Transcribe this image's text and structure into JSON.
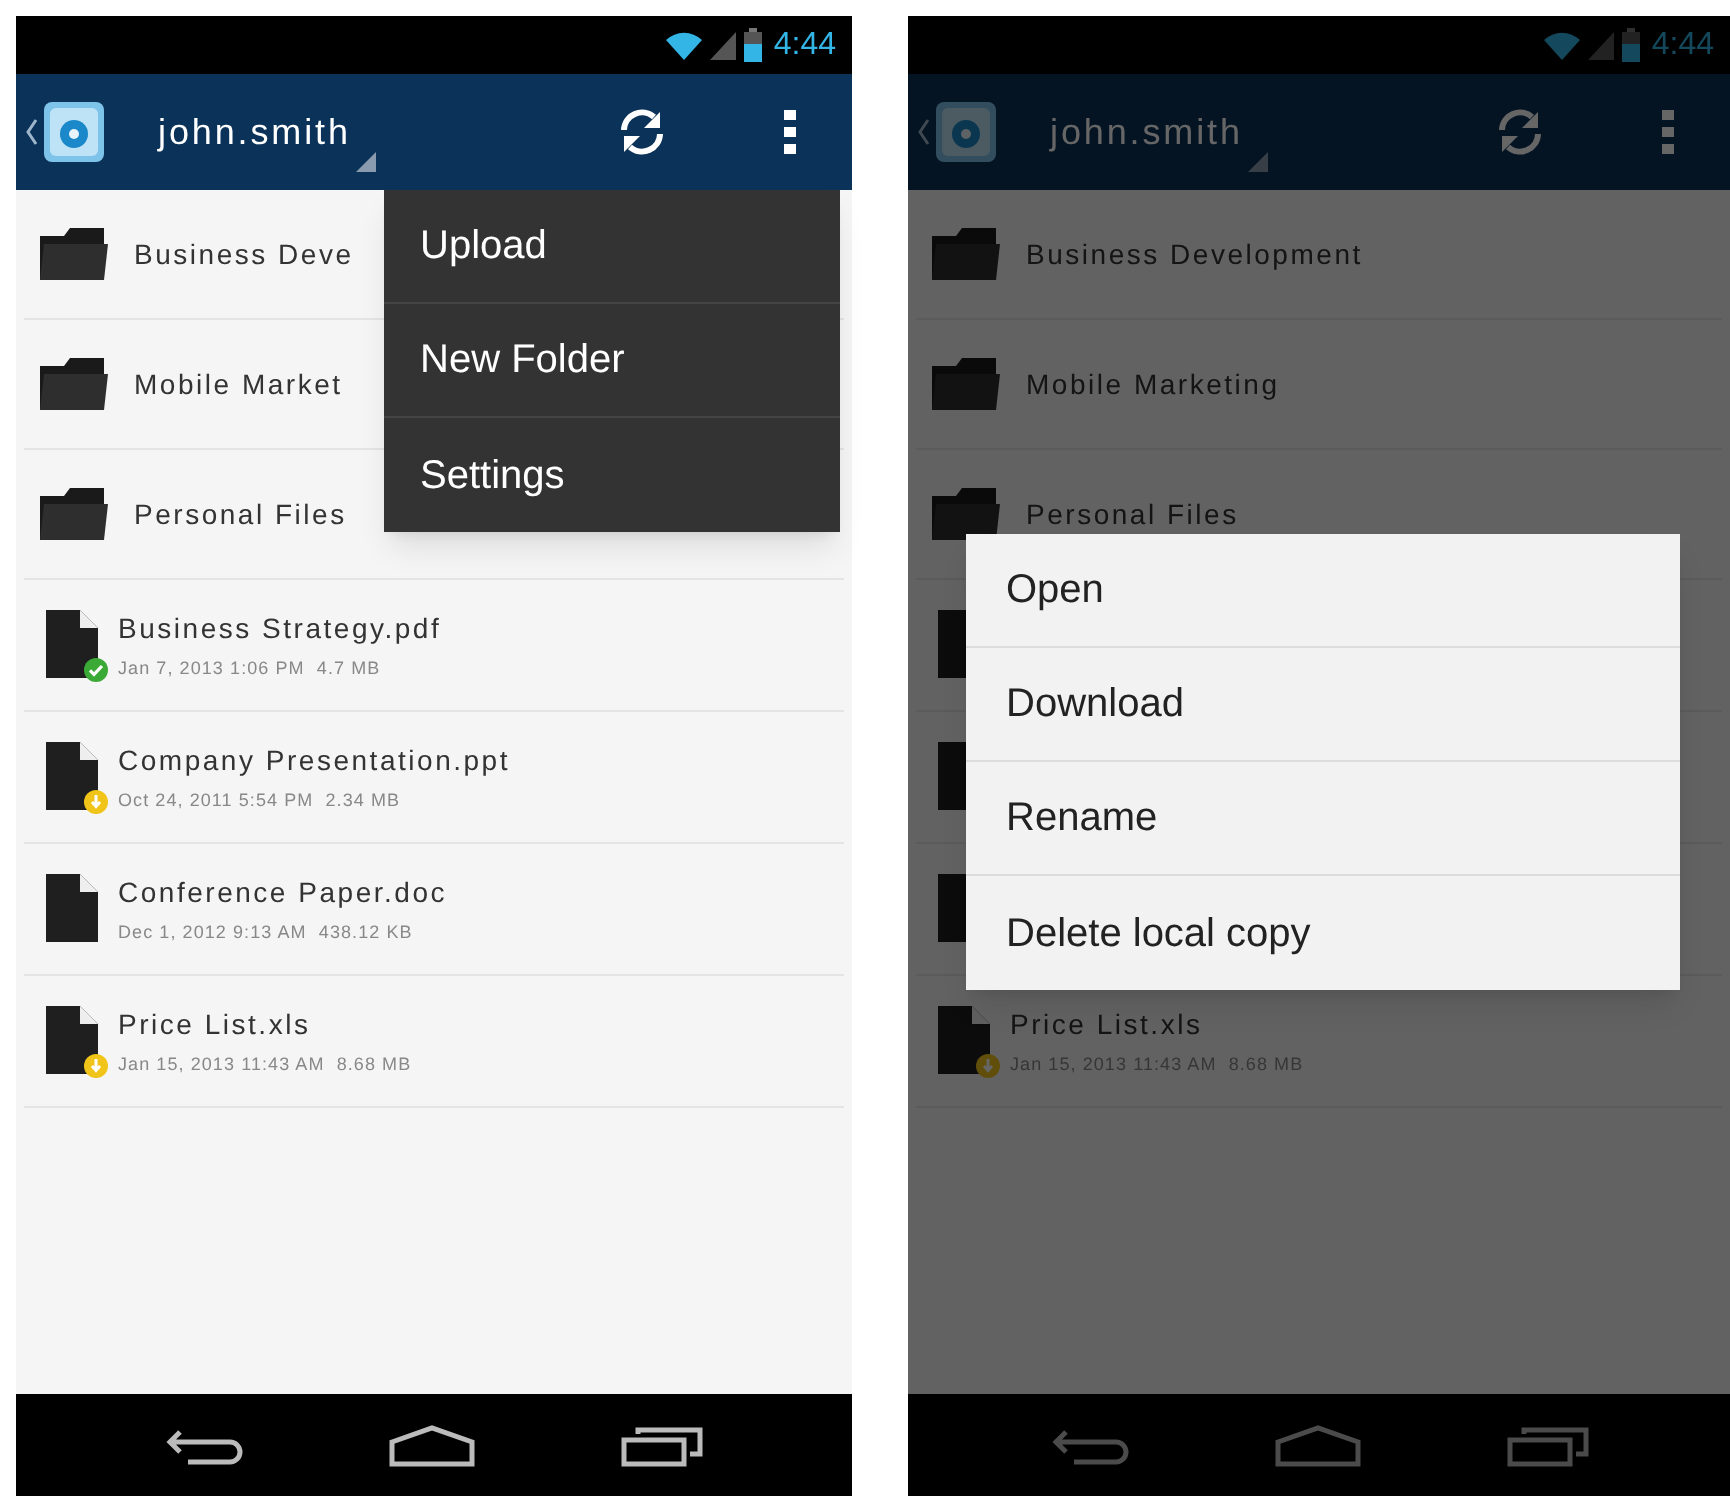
{
  "screens": [
    {
      "dimmed": false,
      "status_bar": {
        "time": "4:44"
      },
      "action_bar": {
        "title": "john.smith"
      },
      "items": [
        {
          "kind": "folder",
          "name": "Business Deve"
        },
        {
          "kind": "folder",
          "name": "Mobile Market"
        },
        {
          "kind": "folder",
          "name": "Personal Files"
        },
        {
          "kind": "file",
          "name": "Business Strategy.pdf",
          "meta": "Jan 7, 2013 1:06 PM  4.7 MB",
          "synced": true,
          "download_available": false
        },
        {
          "kind": "file",
          "name": "Company Presentation.ppt",
          "meta": "Oct 24, 2011 5:54 PM  2.34 MB",
          "synced": false,
          "download_available": true
        },
        {
          "kind": "file",
          "name": "Conference Paper.doc",
          "meta": "Dec 1, 2012 9:13 AM  438.12 KB",
          "synced": false,
          "download_available": false
        },
        {
          "kind": "file",
          "name": "Price List.xls",
          "meta": "Jan 15, 2013 11:43 AM  8.68 MB",
          "synced": false,
          "download_available": true
        }
      ],
      "overflow_menu": {
        "items": [
          "Upload",
          "New Folder",
          "Settings"
        ]
      }
    },
    {
      "dimmed": true,
      "status_bar": {
        "time": "4:44"
      },
      "action_bar": {
        "title": "john.smith"
      },
      "items": [
        {
          "kind": "folder",
          "name": "Business Development"
        },
        {
          "kind": "folder",
          "name": "Mobile Marketing"
        },
        {
          "kind": "folder",
          "name": "Personal Files"
        },
        {
          "kind": "file"
        },
        {
          "kind": "file"
        },
        {
          "kind": "file"
        },
        {
          "kind": "file",
          "name": "Price List.xls",
          "meta": "Jan 15, 2013 11:43 AM  8.68 MB",
          "synced": false,
          "download_available": true
        }
      ],
      "context_menu": {
        "items": [
          "Open",
          "Download",
          "Rename",
          "Delete local copy"
        ]
      }
    }
  ]
}
